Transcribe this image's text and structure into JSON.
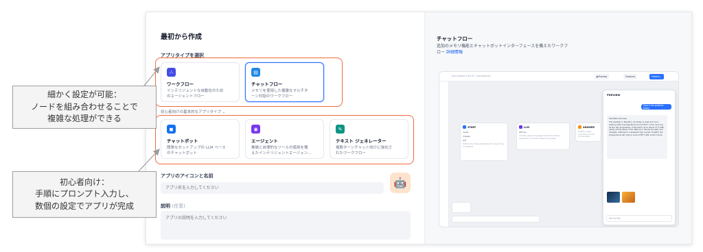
{
  "dialog": {
    "title": "最初から作成",
    "app_type_label": "アプリタイプを選択",
    "advanced_cards": [
      {
        "title": "ワークフロー",
        "desc": "インテリジェントな自動化のため\nのエージェントフロー",
        "icon": "workflow-icon",
        "color": "#444ce7"
      },
      {
        "title": "チャットフロー",
        "desc": "メモリを使用した複雑なマルチタ\nーン対話のワークフロー",
        "icon": "chatflow-icon",
        "color": "#1e88e5"
      }
    ],
    "beginner_toggle": "初心者向けの基本的なアプリタイプ",
    "beginner_cards": [
      {
        "title": "チャットボット",
        "desc": "簡単なセットアップの LLM ベース\nのチャットボット",
        "icon": "chatbot-icon",
        "color": "#1570ef"
      },
      {
        "title": "エージェント",
        "desc": "推論と自律的なツールの使用を備\nえたインテリジェントエージェン…",
        "icon": "agent-icon",
        "color": "#7839ee"
      },
      {
        "title": "テキスト ジェネレーター",
        "desc": "複数ターンチャット向けに強化さ\nれたワークフロー",
        "icon": "text-generator-icon",
        "color": "#0e9384"
      }
    ],
    "icon_name_label": "アプリのアイコンと名前",
    "name_placeholder": "アプリ名を入力してください",
    "desc_label": "説明",
    "desc_optional": "(任意)",
    "desc_placeholder": "アプリの説明を入力してください"
  },
  "right_pane": {
    "title": "チャットフロー",
    "desc": "追加のメモリ機能とチャットボットインターフェースを備えたワークフ\nロー",
    "link": "詳細情報",
    "preview": {
      "top_label": "Auto Added 2/2/2 M · Unpublished",
      "btn_preview": "Preview",
      "btn_features": "Features",
      "btn_publish": "Publish",
      "node_start": "START",
      "node_llm": "LLM",
      "node_answer": "ANSWER",
      "start_fields": [
        "name",
        "images",
        "pdf"
      ],
      "start_note": "Define the initial parameters for launching a workflow",
      "llm_model": "GPT-4o",
      "llm_note": "Invoking large language models to answer questions or process natural language",
      "answer_note": "Define a reply content of a chat conversation",
      "chat_header": "PREVIEW",
      "user_msg": "How's the weather today",
      "bot_tag": "Workflow Process",
      "bot_msg": "The weather in Boydton, VA today is clear and cool, starting with a temperature around 64°F in the morning. As the day progresses, it will warm up to about 77°F with partly cloudy skies in the afternoon. Winds are light and variable, making for a pleasant day overall. Tonight, the temperature will drop to around 58°F with a few clouds.",
      "chat_input_placeholder": "Talk to Bot"
    }
  },
  "annotations": {
    "advanced": "細かく設定が可能：\nノードを組み合わせることで\n複雑な処理ができる",
    "beginner": "初心者向け：\n手順にプロンプト入力し、\n数個の設定でアプリが完成"
  },
  "colors": {
    "highlight": "#ef6a3a",
    "selected_border": "#2970ff",
    "link": "#155eef"
  }
}
